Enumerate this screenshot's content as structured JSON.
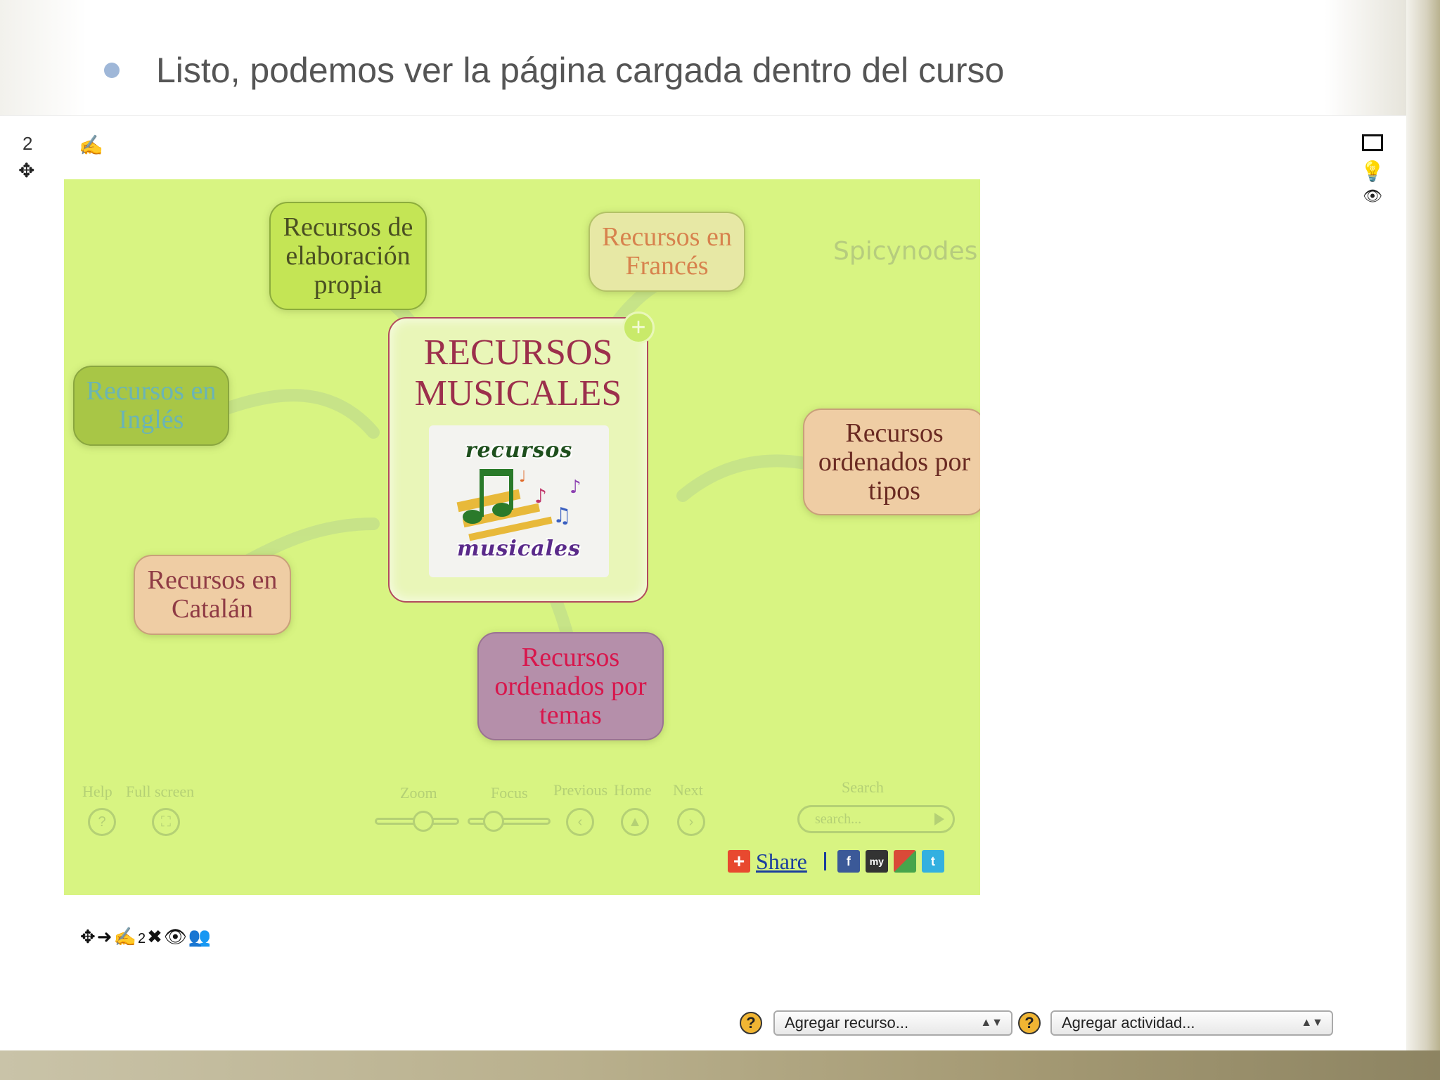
{
  "slide": {
    "bullet_text": "Listo, podemos ver la página cargada dentro del curso"
  },
  "course": {
    "section_number": "2",
    "bottom_tool_count": "2",
    "add_resource_select": "Agregar recurso...",
    "add_activity_select": "Agregar actividad..."
  },
  "mindmap": {
    "logo": "Spicynodes",
    "center": {
      "title_line1": "RECURSOS",
      "title_line2": "MUSICALES",
      "image_top": "recursos",
      "image_bottom": "musicales"
    },
    "nodes": {
      "elaboracion": [
        "Recursos de",
        "elaboración",
        "propia"
      ],
      "frances": [
        "Recursos en",
        "Francés"
      ],
      "ingles": [
        "Recursos en",
        "Inglés"
      ],
      "tipos": [
        "Recursos",
        "ordenados por",
        "tipos"
      ],
      "catalan": [
        "Recursos en",
        "Catalán"
      ],
      "temas": [
        "Recursos",
        "ordenados por",
        "temas"
      ]
    },
    "controls": {
      "help": "Help",
      "fullscreen": "Full screen",
      "zoom": "Zoom",
      "focus": "Focus",
      "previous": "Previous",
      "home": "Home",
      "next": "Next",
      "search": "Search",
      "search_placeholder": "search..."
    },
    "share": {
      "label": "Share",
      "services": [
        "facebook-icon",
        "myspace-icon",
        "google-icon",
        "twitter-icon"
      ],
      "myspace_text": "my"
    }
  },
  "colors": {
    "map_background": "#d8f482",
    "center_border": "#b24a5e",
    "bullet": "#9fb7d8"
  }
}
